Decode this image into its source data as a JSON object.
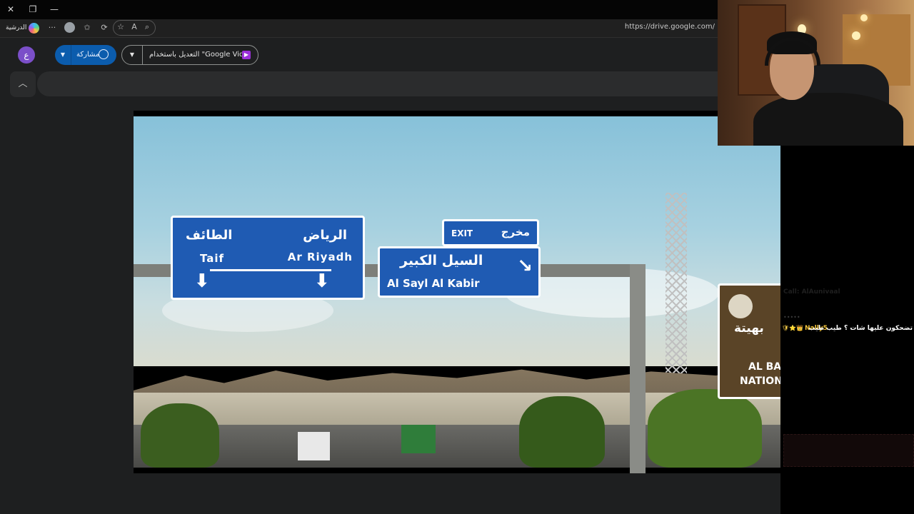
{
  "titlebar": {
    "close_icon": "close-icon",
    "restore_icon": "restore-icon",
    "minimize_icon": "minimize-icon",
    "close_glyph": "✕",
    "restore_glyph": "❐",
    "minimize_glyph": "—"
  },
  "browser": {
    "profile_label": "الدرشية",
    "url": "https://drive.google.com/",
    "more_glyph": "···",
    "read_aloud_glyph": "A",
    "favorites_glyph": "☆"
  },
  "drive": {
    "user_initial": "ع",
    "share_label": "مشاركة",
    "dropdown_glyph": "▼",
    "open_with_label": "التعديل باستخدام \"Google Vids\"",
    "vids_glyph": "▶",
    "collapse_glyph": "︿"
  },
  "video": {
    "sign_main": {
      "riyadh_ar": "الرياض",
      "taif_ar": "الطائف",
      "riyadh_en": "Ar Riyadh",
      "taif_en": "Taif",
      "arrow": "⬇"
    },
    "sign_exit": {
      "exit_en": "EXIT",
      "exit_ar": "مخرج"
    },
    "sign_sayl": {
      "sayl_ar": "السيل الكبير",
      "sayl_en": "Al Sayl Al Kabir",
      "arrow": "↘"
    },
    "sign_brown": {
      "text_ar": "بهيتة",
      "text_en1": "AL BA",
      "text_en2": "NATION"
    }
  },
  "chat": {
    "faded_line": "Call: AlAunivaal",
    "dots": "•••••",
    "badges": "🛡⭐👑",
    "username": "Nally5",
    "separator": ":",
    "message": "تضحكون عليها شات ؟ طيب طيب",
    "accent_color": "#f0c23a"
  }
}
